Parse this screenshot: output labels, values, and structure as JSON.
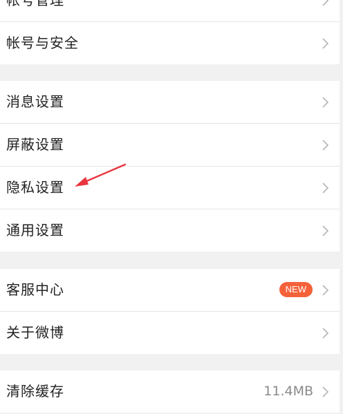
{
  "settings": {
    "items": [
      {
        "label": "帐号管理"
      },
      {
        "label": "帐号与安全"
      },
      {
        "label": "消息设置"
      },
      {
        "label": "屏蔽设置"
      },
      {
        "label": "隐私设置"
      },
      {
        "label": "通用设置"
      },
      {
        "label": "客服中心",
        "badge": "NEW"
      },
      {
        "label": "关于微博"
      },
      {
        "label": "清除缓存",
        "value": "11.4MB"
      }
    ]
  },
  "colors": {
    "background": "#f1f1f1",
    "row": "#ffffff",
    "text": "#222222",
    "muted": "#8a8a8a",
    "badge": "#f5623a",
    "annotation_arrow": "#e8353f"
  },
  "icons": {
    "row_chevron": "chevron-right-icon",
    "annotation": "red-arrow-annotation"
  }
}
